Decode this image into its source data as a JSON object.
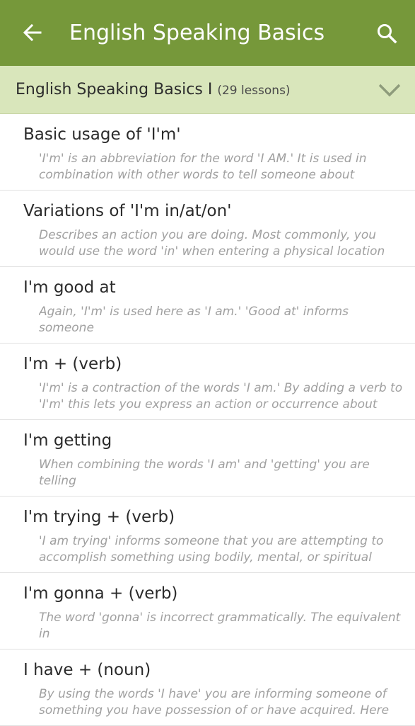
{
  "appbar": {
    "title": "English Speaking Basics",
    "back_icon": "arrow-left-icon",
    "search_icon": "search-icon",
    "color": "#76983a"
  },
  "section": {
    "title": "English Speaking Basics I",
    "count": "(29 lessons)",
    "chevron_icon": "chevron-down-icon",
    "color": "#d9e6bb"
  },
  "lessons": [
    {
      "title": "Basic usage of 'I'm'",
      "desc": "'I'm' is an abbreviation for the word 'I AM.' It is used in\ncombination with other words to tell someone about yourself"
    },
    {
      "title": "Variations of 'I'm in/at/on'",
      "desc": "Describes an action you are doing. Most commonly, you\nwould use the word 'in' when entering a physical location"
    },
    {
      "title": "I'm good at",
      "desc": "Again, 'I'm' is used here as 'I am.' 'Good at' informs someone\nwhat you excel at and are comfortable doing. Here are some"
    },
    {
      "title": "I'm + (verb)",
      "desc": "'I'm' is a contraction of the words 'I am.' By adding a verb to\n'I'm' this lets you express an action or occurrence about"
    },
    {
      "title": "I'm getting",
      "desc": "When combining the words 'I am' and 'getting' you are telling\nsomeone 'you' are gaining possession, being affected by or"
    },
    {
      "title": "I'm trying + (verb)",
      "desc": "'I am trying' informs someone that you are attempting to\naccomplish something using bodily, mental, or spiritual"
    },
    {
      "title": "I'm gonna + (verb)",
      "desc": "The word 'gonna' is incorrect grammatically. The equivalent in\nproper grammar would be 'going to.' When using the word"
    },
    {
      "title": "I have + (noun)",
      "desc": "By using the words 'I have' you are informing someone of\nsomething you have possession of or have acquired. Here"
    }
  ]
}
